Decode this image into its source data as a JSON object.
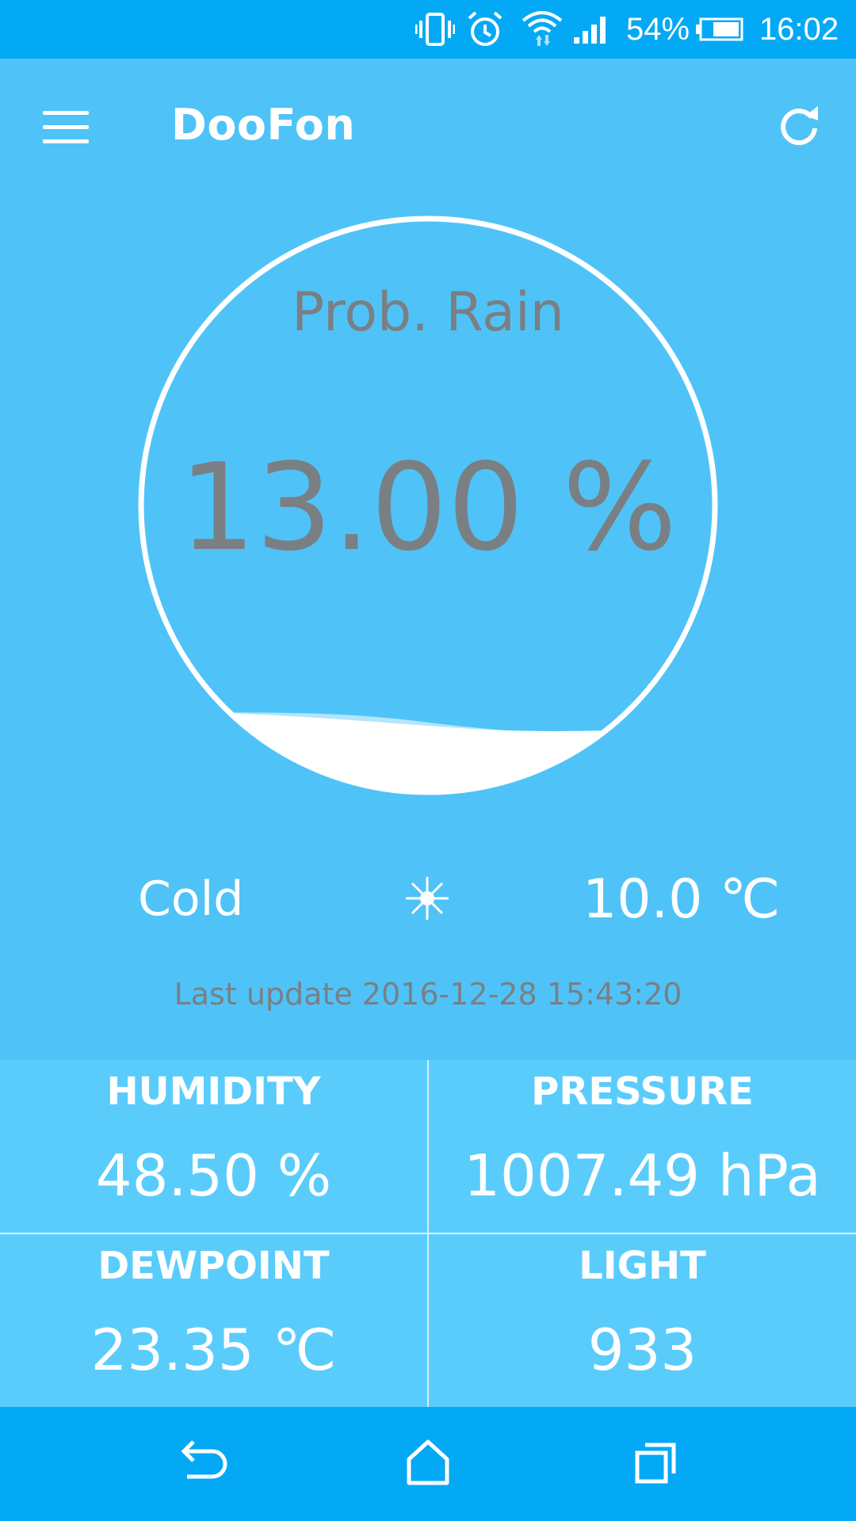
{
  "status_bar": {
    "battery": "54%",
    "time": "16:02",
    "icons": [
      "vibrate-icon",
      "alarm-icon",
      "wifi-icon",
      "signal-icon",
      "battery-icon"
    ]
  },
  "app_bar": {
    "title": "DooFon",
    "icons": [
      "menu-icon",
      "refresh-icon"
    ]
  },
  "gauge": {
    "label": "Prob. Rain",
    "value": "13.00 %",
    "fill_percent": 13
  },
  "condition": {
    "text": "Cold",
    "icon": "snowflake-icon",
    "temperature": "10.0 ℃"
  },
  "last_update": "Last update 2016-12-28 15:43:20",
  "stats": [
    {
      "label": "HUMIDITY",
      "value": "48.50 %"
    },
    {
      "label": "PRESSURE",
      "value": "1007.49 hPa"
    },
    {
      "label": "DEWPOINT",
      "value": "23.35 ℃"
    },
    {
      "label": "LIGHT",
      "value": "933"
    }
  ],
  "nav_bar": {
    "icons": [
      "back-icon",
      "home-icon",
      "recents-icon"
    ]
  },
  "colors": {
    "background": "#4fc3f7",
    "status_bar": "#03a9f4",
    "stats_panel": "#5accfc",
    "gauge_text": "#7a7f84",
    "white": "#ffffff"
  }
}
